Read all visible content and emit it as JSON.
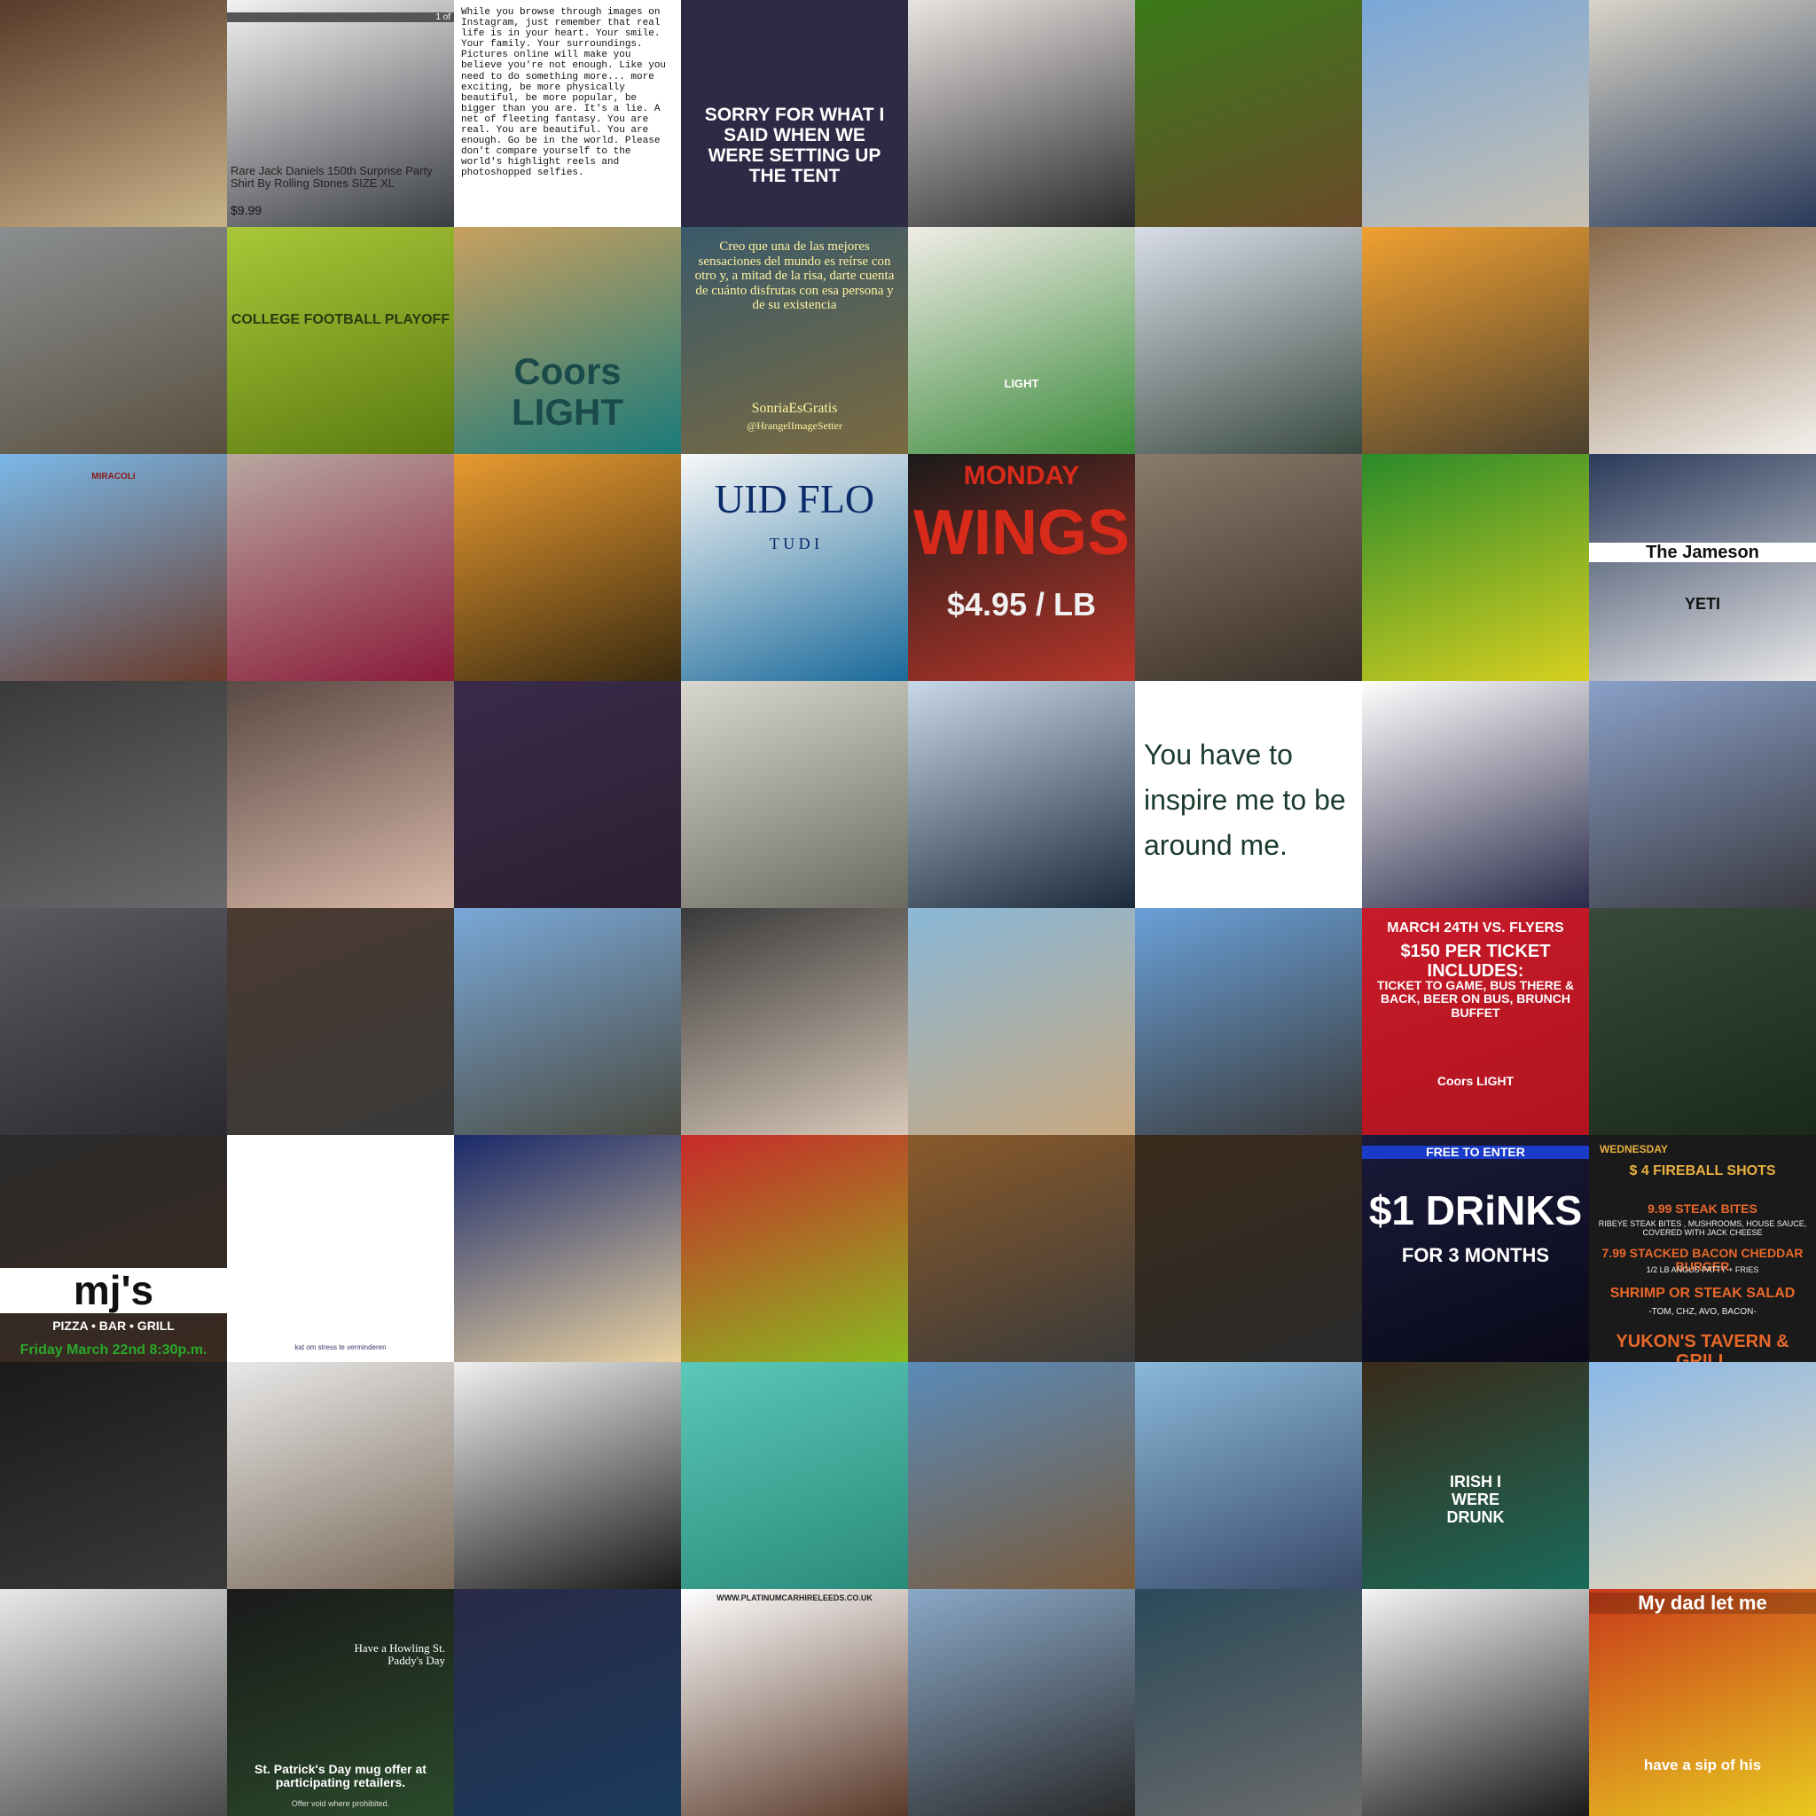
{
  "tiles": [
    {
      "bg": "#5a3a2a,#c9b48a"
    },
    {
      "bg": "#f2f2f2,#3a3d42",
      "texts": [
        "Rare Jack Daniels 150th Surprise Party Shirt By Rolling Stones SIZE XL",
        "$9.99",
        "1 of"
      ]
    },
    {
      "bg": "#ffffff,#ffffff",
      "texts": [
        "While you browse through images on Instagram, just remember that real life is in your heart. Your smile. Your family. Your surroundings. Pictures online will make you believe you're not enough. Like you need to do something more... more exciting, be more physically beautiful, be more popular, be bigger than you are. It's a lie. A net of fleeting fantasy. You are real. You are beautiful. You are enough. Go be in the world. Please don't compare yourself to the world's highlight reels and photoshopped selfies."
      ]
    },
    {
      "bg": "#2c2a44,#2c2a44",
      "texts": [
        "SORRY FOR WHAT I SAID WHEN WE WERE SETTING UP THE TENT"
      ]
    },
    {
      "bg": "#e8e4e2,#2a2a2a"
    },
    {
      "bg": "#3a7a1a,#6b4a2a"
    },
    {
      "bg": "#7aa7d8,#c8c0b0"
    },
    {
      "bg": "#d8d4c8,#2a3a5a"
    },
    {
      "bg": "#8a8e90,#5a5040"
    },
    {
      "bg": "#a9c838,#5a7a10",
      "texts": [
        "COLLEGE FOOTBALL PLAYOFF"
      ]
    },
    {
      "bg": "#c8a060,#1a7a7a",
      "texts": [
        "Coors LIGHT"
      ]
    },
    {
      "bg": "#3a5a6a,#7a6a40",
      "texts": [
        "Creo que una de las mejores sensaciones del mundo es reírse con otro y, a mitad de la risa, darte cuenta de cuánto disfrutas con esa persona y de su existencia",
        "SonriaEsGratis",
        "@HrangelImageSetter"
      ]
    },
    {
      "bg": "#f0ece6,#3a8a3a",
      "texts": [
        "LIGHT"
      ]
    },
    {
      "bg": "#d8dde8,#3a4a40"
    },
    {
      "bg": "#f0a030,#4a4030"
    },
    {
      "bg": "#8a6a4a,#f2f0ec"
    },
    {
      "bg": "#7ab8e8,#6a3a2a",
      "texts": [
        "MIRACOLI"
      ]
    },
    {
      "bg": "#b8a8a0,#8a1a3a"
    },
    {
      "bg": "#e89a30,#3a2a10"
    },
    {
      "bg": "#f8f8f8,#1a6a9a",
      "texts": [
        "UID FLO",
        "T U D I"
      ]
    },
    {
      "bg": "#1a1a1a,#b8362a",
      "texts": [
        "MONDAY",
        "WINGS",
        "$4.95 / LB"
      ]
    },
    {
      "bg": "#8a7a6a,#3a3028"
    },
    {
      "bg": "#2a8a2a,#d8d020"
    },
    {
      "bg": "#2a3a5a,#e8e8e8",
      "texts": [
        "The Jameson",
        "YETI"
      ]
    },
    {
      "bg": "#3a3a3a,#6a6a6a"
    },
    {
      "bg": "#5a4a44,#d8b8a8"
    },
    {
      "bg": "#3a2a4a,#2a2030"
    },
    {
      "bg": "#d8d8d0,#6a6a60"
    },
    {
      "bg": "#c8d8e8,#1a2a3a"
    },
    {
      "bg": "#ffffff,#ffffff",
      "texts": [
        "You have to inspire me to be around me."
      ]
    },
    {
      "bg": "#ffffff,#2a2a4a"
    },
    {
      "bg": "#8aa0c8,#3a3a40"
    },
    {
      "bg": "#5a5a60,#2a2a30"
    },
    {
      "bg": "#4a3a30,#3a3a3a"
    },
    {
      "bg": "#7aa8d8,#4a4a40"
    },
    {
      "bg": "#3a3a3a,#d8c8b8"
    },
    {
      "bg": "#8ab8d8,#c8a880"
    },
    {
      "bg": "#6aa0d8,#3a3a3a"
    },
    {
      "bg": "#c81a2a,#b0141e",
      "texts": [
        "MARCH 24TH VS. FLYERS",
        "$150 PER TICKET INCLUDES:",
        "TICKET TO GAME, BUS THERE & BACK, BEER ON BUS, BRUNCH BUFFET",
        "Coors LIGHT"
      ]
    },
    {
      "bg": "#3a4a3a,#1a2a1a"
    },
    {
      "bg": "#2a2a2a,#3a2a20",
      "texts": [
        "mj's",
        "PIZZA • BAR • GRILL",
        "Friday March 22nd 8:30p.m."
      ]
    },
    {
      "bg": "#ffffff,#ffffff",
      "texts": [
        "kat om stress te verminderen"
      ]
    },
    {
      "bg": "#1a2a6a,#e8d0a0"
    },
    {
      "bg": "#c82a2a,#8ab820"
    },
    {
      "bg": "#8a5a2a,#3a3a3a"
    },
    {
      "bg": "#3a2a1a,#2a2a2a"
    },
    {
      "bg": "#1a1a3a,#0a0a1a",
      "texts": [
        "FREE TO ENTER",
        "$1 DRiNKS",
        "FOR 3 MONTHS"
      ]
    },
    {
      "bg": "#1a1a1a,#1a1a1a",
      "texts": [
        "WEDNESDAY",
        "$ 4 FIREBALL SHOTS",
        "9.99 STEAK BITES",
        "RIBEYE STEAK BITES , MUSHROOMS, HOUSE SAUCE, COVERED WITH JACK CHEESE",
        "7.99 STACKED BACON CHEDDAR BURGER",
        "1/2 LB ANGUS PATTY + FRIES",
        "SHRIMP OR STEAK SALAD",
        "-TOM, CHZ, AVO, BACON-",
        "YUKON'S TAVERN & GRILL"
      ]
    },
    {
      "bg": "#1a1a1a,#3a3a3a"
    },
    {
      "bg": "#e8e8e8,#7a6a5a"
    },
    {
      "bg": "#f0f0f0,#1a1a1a"
    },
    {
      "bg": "#5ac8b8,#2a8a7a"
    },
    {
      "bg": "#5a8ab8,#7a5a3a"
    },
    {
      "bg": "#8ab8d8,#3a4a6a"
    },
    {
      "bg": "#3a2a1a,#1a6a5a",
      "texts": [
        "IRISH I WERE DRUNK"
      ]
    },
    {
      "bg": "#8ab8e8,#e8d8b8"
    },
    {
      "bg": "#e8e8e8,#4a4a4a"
    },
    {
      "bg": "#1a1a1a,#2a4a2a",
      "texts": [
        "Have a Howling St. Paddy's Day",
        "St. Patrick's Day mug offer at participating retailers.",
        "Offer void where prohibited."
      ]
    },
    {
      "bg": "#2a2a4a,#1a3a5a"
    },
    {
      "bg": "#ffffff,#5a3a2a",
      "texts": [
        "WWW.PLATINUMCARHIRELEEDS.CO.UK"
      ]
    },
    {
      "bg": "#8aa8c8,#2a2a2a"
    },
    {
      "bg": "#2a4a5a,#6a6a6a"
    },
    {
      "bg": "#f4f4f4,#1a1a1a"
    },
    {
      "bg": "#c83a1a,#e8c820",
      "texts": [
        "My dad let me",
        "have a sip of his"
      ]
    }
  ]
}
